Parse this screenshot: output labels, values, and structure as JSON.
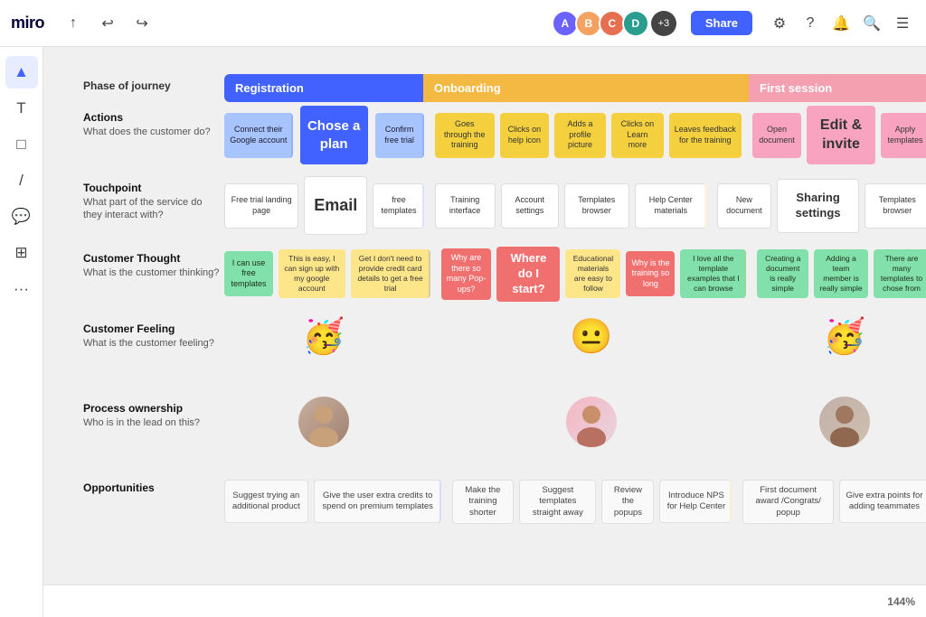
{
  "app": {
    "logo": "miro",
    "zoom": "144%"
  },
  "toolbar": {
    "upload_icon": "↑",
    "undo_icon": "↩",
    "redo_icon": "↪"
  },
  "avatars": [
    {
      "initials": "A",
      "color": "#6c63ff"
    },
    {
      "initials": "B",
      "color": "#f4a261"
    },
    {
      "initials": "C",
      "color": "#e76f51"
    },
    {
      "initials": "D",
      "color": "#2a9d8f"
    }
  ],
  "avatar_count": "+3",
  "share_label": "Share",
  "phases": {
    "registration": "Registration",
    "onboarding": "Onboarding",
    "first_session": "First session"
  },
  "rows": {
    "actions": {
      "title": "Actions",
      "subtitle": "What does the customer do?",
      "reg_items": [
        "Connect their Google account",
        "Chose a plan",
        "Confirm free trial"
      ],
      "onb_items": [
        "Goes through the training",
        "Clicks on help icon",
        "Adds a profile picture",
        "Clicks on Learn more",
        "Leaves feedback for the training"
      ],
      "fs_items": [
        "Open document",
        "Edit & invite",
        "Apply templates"
      ]
    },
    "touchpoint": {
      "title": "Touchpoint",
      "subtitle": "What part of the service do they interact with?",
      "reg_items": [
        "Free trial landing page",
        "Email",
        "free templates"
      ],
      "onb_items": [
        "Training interface",
        "Account settings",
        "Templates browser",
        "Help Center materials"
      ],
      "fs_items": [
        "New document",
        "Sharing settings",
        "Templates browser"
      ]
    },
    "thought": {
      "title": "Customer Thought",
      "subtitle": "What is the customer thinking?",
      "reg_items": [
        "I can use free templates",
        "This is easy, I can sign up with my google account",
        "Get I don't need to provide credit card details to get a free trial"
      ],
      "onb_items": [
        "Why are there so many Pop-ups?",
        "Where do I start?",
        "Educational materials are easy to follow",
        "Why is the training so long",
        "I love all the template examples that I can browse"
      ],
      "fs_items": [
        "Creating a document is really simple",
        "Adding a team member is really simple",
        "There are many templates to chose from"
      ]
    },
    "feeling": {
      "title": "Customer Feeling",
      "subtitle": "What is the customer feeling?",
      "reg_emoji": "🥳",
      "onb_emoji": "😐",
      "fs_emoji": "🥳"
    },
    "ownership": {
      "title": "Process ownership",
      "subtitle": "Who is in the lead on this?"
    },
    "opportunities": {
      "title": "Opportunities",
      "reg_items": [
        "Suggest trying an additional product",
        "Give the user extra credits to spend on premium templates"
      ],
      "onb_items": [
        "Make the training shorter",
        "Suggest templates straight away",
        "Review the popups",
        "Introduce NPS for Help Center"
      ],
      "fs_items": [
        "First document award /Congrats/ popup",
        "Give extra points for adding teammates"
      ]
    }
  },
  "bottom": {
    "expand": ">>",
    "zoom": "144%"
  }
}
